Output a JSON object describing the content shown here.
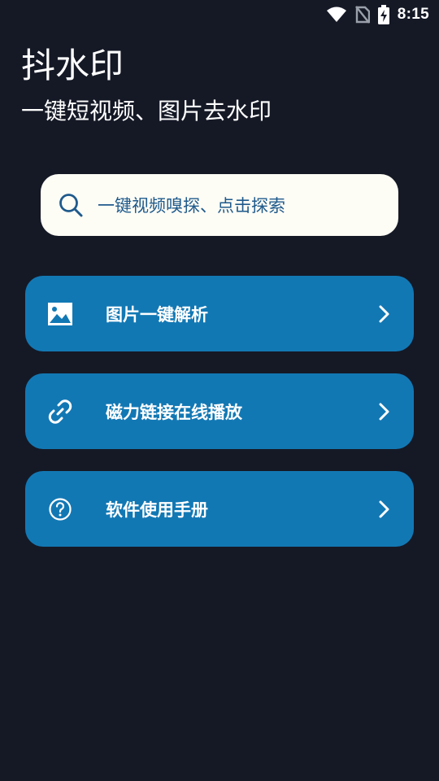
{
  "status_bar": {
    "time": "8:15",
    "icons": [
      "wifi-icon",
      "no-sim-icon",
      "battery-charging-icon"
    ]
  },
  "header": {
    "title": "抖水印",
    "subtitle": "一键短视频、图片去水印"
  },
  "search": {
    "placeholder": "一键视频嗅探、点击探索",
    "icon": "search-icon"
  },
  "menu": {
    "items": [
      {
        "label": "图片一键解析",
        "icon": "image-icon"
      },
      {
        "label": "磁力链接在线播放",
        "icon": "link-icon"
      },
      {
        "label": "软件使用手册",
        "icon": "help-circle-icon"
      }
    ]
  },
  "colors": {
    "background": "#151926",
    "card": "#1278b4",
    "search_bg": "#fdfcf5",
    "search_text": "#1f5a8c"
  }
}
